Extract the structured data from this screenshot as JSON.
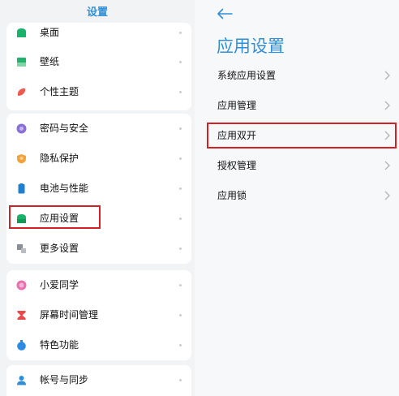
{
  "left": {
    "title": "设置",
    "groups": [
      {
        "items": [
          {
            "label": "桌面"
          },
          {
            "label": "壁纸"
          },
          {
            "label": "个性主题"
          }
        ]
      },
      {
        "items": [
          {
            "label": "密码与安全"
          },
          {
            "label": "隐私保护"
          },
          {
            "label": "电池与性能"
          },
          {
            "label": "应用设置"
          },
          {
            "label": "更多设置"
          }
        ]
      },
      {
        "items": [
          {
            "label": "小爱同学"
          },
          {
            "label": "屏幕时间管理"
          },
          {
            "label": "特色功能"
          }
        ]
      },
      {
        "items": [
          {
            "label": "帐号与同步"
          }
        ]
      }
    ]
  },
  "right": {
    "title": "应用设置",
    "items": [
      {
        "label": "系统应用设置"
      },
      {
        "label": "应用管理"
      },
      {
        "label": "应用双开"
      },
      {
        "label": "授权管理"
      },
      {
        "label": "应用锁"
      }
    ]
  },
  "colors": {
    "accent": "#2f8fd6",
    "highlight": "#d41f24"
  },
  "icons": [
    "desktop-icon",
    "wallpaper-icon",
    "theme-icon",
    "password-security-icon",
    "privacy-icon",
    "battery-icon",
    "app-settings-icon",
    "more-settings-icon",
    "xiaoai-icon",
    "screen-time-icon",
    "features-icon",
    "account-sync-icon",
    "back-arrow-icon",
    "chevron-right-icon"
  ]
}
